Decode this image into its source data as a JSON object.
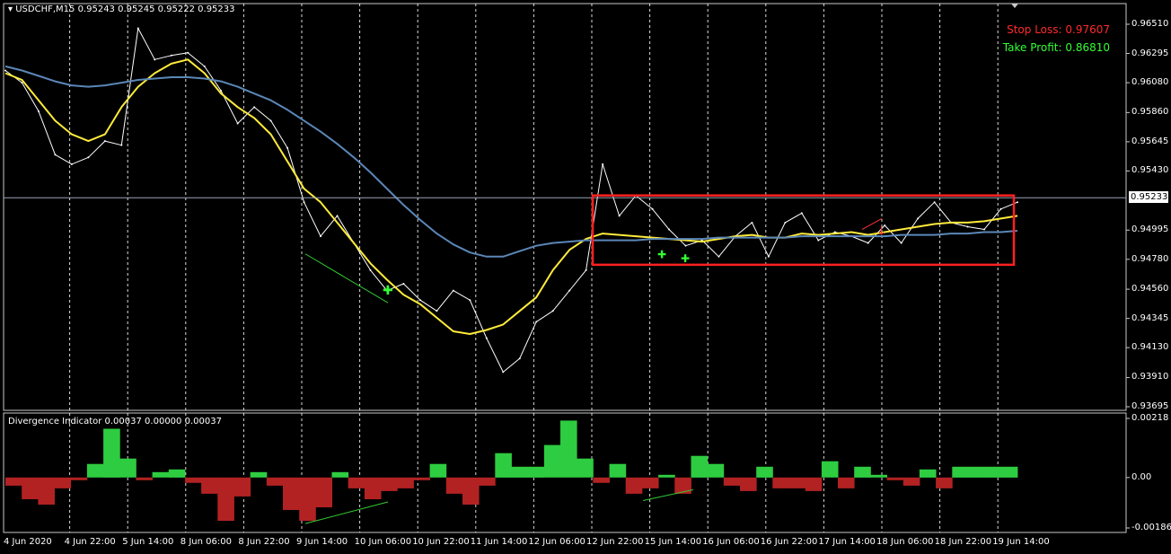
{
  "main": {
    "symbol_caption": "USDCHF,M15",
    "ohlc_caption": "0.95243 0.95245 0.95222 0.95233",
    "stop_loss": "Stop Loss: 0.97607",
    "take_profit": "Take Profit: 0.86810",
    "current_price": "0.95233",
    "price_ticks": [
      "0.96510",
      "0.96295",
      "0.96080",
      "0.95860",
      "0.95645",
      "0.95430",
      "0.94995",
      "0.94780",
      "0.94560",
      "0.94345",
      "0.94130",
      "0.93910",
      "0.93695"
    ]
  },
  "indicator": {
    "caption": "Divergence Indicator 0.00037 0.00000 0.00037",
    "ticks": [
      "0.00218",
      "0.00",
      "-0.00186"
    ]
  },
  "time_labels": [
    "4 Jun 2020",
    "4 Jun 22:00",
    "5 Jun 14:00",
    "8 Jun 06:00",
    "8 Jun 22:00",
    "9 Jun 14:00",
    "10 Jun 06:00",
    "10 Jun 22:00",
    "11 Jun 14:00",
    "12 Jun 06:00",
    "12 Jun 22:00",
    "15 Jun 14:00",
    "16 Jun 06:00",
    "16 Jun 22:00",
    "17 Jun 14:00",
    "18 Jun 06:00",
    "18 Jun 22:00",
    "19 Jun 14:00"
  ],
  "colors": {
    "price": "#ffffff",
    "ma_fast": "#ffeb3b",
    "ma_slow": "#5b87b8",
    "hist_up": "#2ecc40",
    "hist_down": "#b22222",
    "range_box": "#ff2020",
    "divergence_line": "#33cc33"
  },
  "chart_data": [
    {
      "type": "line",
      "title": "USDCHF,M15",
      "ylim": [
        0.93695,
        0.9651
      ],
      "series": [
        {
          "name": "price",
          "values": [
            0.9617,
            0.9608,
            0.9587,
            0.9555,
            0.9548,
            0.9553,
            0.9565,
            0.9562,
            0.9648,
            0.9625,
            0.9628,
            0.963,
            0.962,
            0.9602,
            0.9578,
            0.959,
            0.958,
            0.956,
            0.952,
            0.9495,
            0.951,
            0.949,
            0.947,
            0.9455,
            0.946,
            0.9448,
            0.944,
            0.9455,
            0.9448,
            0.942,
            0.9395,
            0.9405,
            0.9432,
            0.944,
            0.9455,
            0.947,
            0.9548,
            0.951,
            0.9525,
            0.9515,
            0.95,
            0.9488,
            0.9492,
            0.948,
            0.9495,
            0.9505,
            0.948,
            0.9505,
            0.9512,
            0.9492,
            0.9498,
            0.9495,
            0.949,
            0.9503,
            0.949,
            0.9508,
            0.952,
            0.9505,
            0.9502,
            0.95,
            0.9515,
            0.952
          ]
        },
        {
          "name": "ma_fast",
          "values": [
            0.9615,
            0.961,
            0.9595,
            0.958,
            0.957,
            0.9565,
            0.957,
            0.959,
            0.9605,
            0.9615,
            0.9622,
            0.9625,
            0.9615,
            0.96,
            0.959,
            0.9582,
            0.957,
            0.955,
            0.953,
            0.952,
            0.9505,
            0.949,
            0.9475,
            0.9463,
            0.9452,
            0.9445,
            0.9435,
            0.9425,
            0.9423,
            0.9426,
            0.943,
            0.944,
            0.945,
            0.947,
            0.9485,
            0.9493,
            0.9497,
            0.9496,
            0.9495,
            0.9494,
            0.9493,
            0.9492,
            0.9491,
            0.9493,
            0.9495,
            0.9496,
            0.9494,
            0.9494,
            0.9497,
            0.9496,
            0.9497,
            0.9498,
            0.9496,
            0.9498,
            0.95,
            0.9502,
            0.9504,
            0.9505,
            0.9505,
            0.9506,
            0.9508,
            0.951
          ]
        },
        {
          "name": "ma_slow",
          "values": [
            0.962,
            0.9617,
            0.9613,
            0.9609,
            0.9606,
            0.9605,
            0.9606,
            0.9608,
            0.961,
            0.9611,
            0.9612,
            0.9612,
            0.9611,
            0.9609,
            0.9605,
            0.96,
            0.9595,
            0.9588,
            0.958,
            0.9572,
            0.9563,
            0.9553,
            0.9542,
            0.953,
            0.9518,
            0.9507,
            0.9497,
            0.9489,
            0.9483,
            0.948,
            0.948,
            0.9484,
            0.9488,
            0.949,
            0.9491,
            0.9492,
            0.9492,
            0.9492,
            0.9492,
            0.9493,
            0.9493,
            0.9493,
            0.9493,
            0.9494,
            0.9494,
            0.9494,
            0.9494,
            0.9494,
            0.9495,
            0.9495,
            0.9495,
            0.9495,
            0.9495,
            0.9495,
            0.9496,
            0.9496,
            0.9496,
            0.9497,
            0.9497,
            0.9498,
            0.9498,
            0.9499
          ]
        }
      ]
    },
    {
      "type": "bar",
      "title": "Divergence Indicator",
      "ylim": [
        -0.00186,
        0.00218
      ],
      "series": [
        {
          "name": "divergence",
          "values": [
            -0.0003,
            -0.0008,
            -0.001,
            -0.0004,
            -0.0001,
            0.0005,
            0.0018,
            0.0007,
            -0.0001,
            0.0002,
            0.0003,
            -0.0002,
            -0.0006,
            -0.0016,
            -0.0007,
            0.0002,
            -0.0003,
            -0.0012,
            -0.0016,
            -0.0011,
            0.0002,
            -0.0004,
            -0.0008,
            -0.0005,
            -0.0004,
            -0.0001,
            0.0005,
            -0.0006,
            -0.001,
            -0.0003,
            0.0009,
            0.0004,
            0.0004,
            0.0012,
            0.0021,
            0.0007,
            -0.0002,
            0.0005,
            -0.0006,
            -0.0004,
            0.0001,
            -0.0006,
            0.0008,
            0.0005,
            -0.0003,
            -0.0005,
            0.0004,
            -0.0004,
            -0.0004,
            -0.0005,
            0.0006,
            -0.0004,
            0.0004,
            0.0001,
            -0.0001,
            -0.0003,
            0.0003,
            -0.0004,
            0.0004,
            0.0004,
            0.0004,
            0.0004
          ]
        }
      ]
    }
  ]
}
